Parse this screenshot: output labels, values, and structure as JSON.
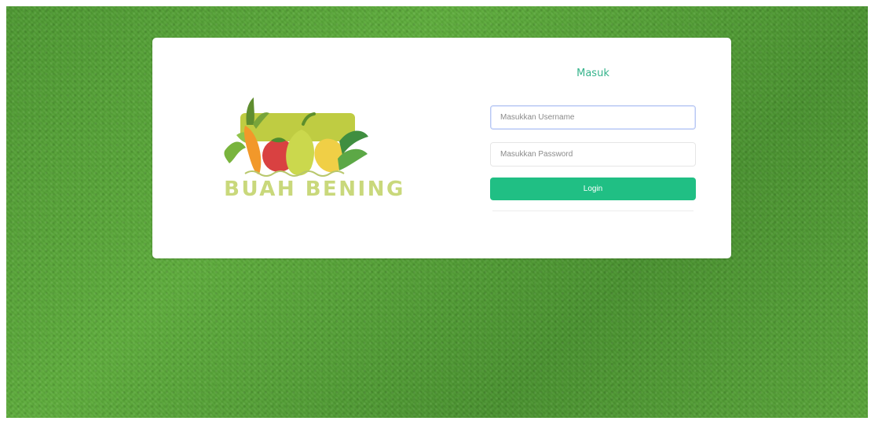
{
  "brand": {
    "name": "BUAH BENING",
    "logo": "fruit-vegetable-logo"
  },
  "login": {
    "title": "Masuk",
    "username_placeholder": "Masukkan Username",
    "password_placeholder": "Masukkan Password",
    "button_label": "Login"
  },
  "colors": {
    "background": "#5aa63a",
    "brand_text": "#c9d87b",
    "title_accent": "#35b38b",
    "button": "#20bf84"
  }
}
